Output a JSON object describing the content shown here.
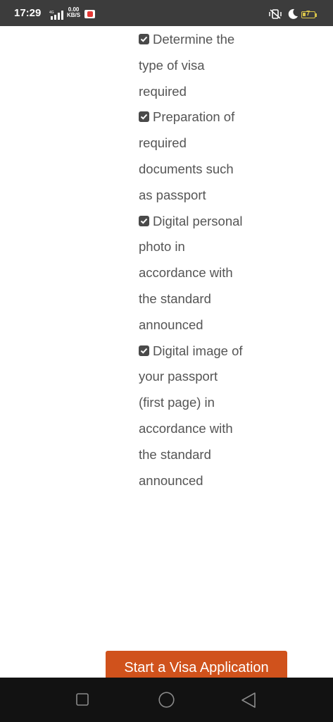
{
  "status_bar": {
    "time": "17:29",
    "network": "4G",
    "net_speed_value": "0.00",
    "net_speed_unit": "KB/S",
    "battery_level": "7",
    "icons": [
      "signal-icon",
      "youtube-icon",
      "vibrate-icon",
      "do-not-disturb-moon-icon",
      "battery-icon"
    ]
  },
  "checklist": {
    "items": [
      {
        "label": "Determine the type of visa required",
        "checked": true
      },
      {
        "label": "Preparation of required documents such as passport",
        "checked": true
      },
      {
        "label": "Digital personal photo in accordance with the standard announced",
        "checked": true
      },
      {
        "label": "Digital image of your passport (first page) in accordance with the standard announced",
        "checked": true
      }
    ]
  },
  "cta": {
    "label": "Start a Visa Application",
    "color": "#d0521c"
  },
  "nav_bar": {
    "icons": [
      "recent-apps-icon",
      "home-icon",
      "back-icon"
    ]
  }
}
